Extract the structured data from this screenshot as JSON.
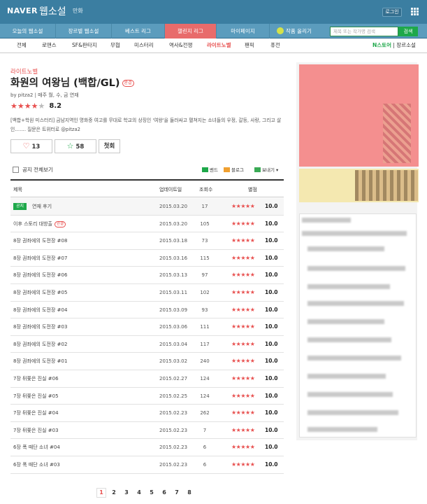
{
  "topbar": {
    "logo": "NAVER",
    "service": "웹소설",
    "comic": "만화",
    "login": "로그인"
  },
  "mainnav": {
    "tabs": [
      {
        "label": "오늘의 웹소설"
      },
      {
        "label": "장르별 웹소설"
      },
      {
        "label": "베스트 리그"
      },
      {
        "label": "챌린지 리그",
        "active": true
      },
      {
        "label": "마이페이지"
      }
    ],
    "upload": "작품 올리기",
    "search_placeholder": "제목 또는 작가명 검색",
    "search_button": "검색"
  },
  "genrenav": {
    "items": [
      "전체",
      "로맨스",
      "SF&판타지",
      "무협",
      "미스터리",
      "역사&전쟁",
      "라이트노벨",
      "팬픽",
      "퓨전"
    ],
    "active": "라이트노벨",
    "nstore_brand": "N스토어",
    "nstore_label": "장르소설"
  },
  "work": {
    "genre": "라이트노벨",
    "title": "화원의 여왕님 (백합/GL)",
    "new_badge": "완결",
    "byline": "by   pitza2   |   매주 월, 수, 금 연재",
    "rating": "8.2",
    "stars_filled": 4,
    "description": "[백합+학원 미스터리] 금남지역인 명화중 여고를 무대로 학교의 상징인 '여왕'을 둘러싸고 펼쳐지는 소녀들의 우정, 갈등, 사랑, 그리고 살인……. 질문은 트위터로 @pitza2",
    "like_count": "13",
    "favorite_count": "58",
    "first_episode": "첫회"
  },
  "list_controls": {
    "notice_toggle": "공지 전체보기",
    "share_band": "밴드",
    "share_blog": "블로그",
    "share_more": "보내기"
  },
  "table": {
    "headers": {
      "title": "제목",
      "date": "업데이트일",
      "views": "조회수",
      "score": "별점"
    },
    "rows": [
      {
        "notice": "공지",
        "title": "연재 후기",
        "date": "2015.03.20",
        "views": "17",
        "score": "10.0"
      },
      {
        "title": "이후 스토리 대방출",
        "new": "완결",
        "date": "2015.03.20",
        "views": "105",
        "score": "10.0"
      },
      {
        "title": "8장 권좌에의 도전장 #08",
        "date": "2015.03.18",
        "views": "73",
        "score": "10.0"
      },
      {
        "title": "8장 권좌에의 도전장 #07",
        "date": "2015.03.16",
        "views": "115",
        "score": "10.0"
      },
      {
        "title": "8장 권좌에의 도전장 #06",
        "date": "2015.03.13",
        "views": "97",
        "score": "10.0"
      },
      {
        "title": "8장 권좌에의 도전장 #05",
        "date": "2015.03.11",
        "views": "102",
        "score": "10.0"
      },
      {
        "title": "8장 권좌에의 도전장 #04",
        "date": "2015.03.09",
        "views": "93",
        "score": "10.0"
      },
      {
        "title": "8장 권좌에의 도전장 #03",
        "date": "2015.03.06",
        "views": "111",
        "score": "10.0"
      },
      {
        "title": "8장 권좌에의 도전장 #02",
        "date": "2015.03.04",
        "views": "117",
        "score": "10.0"
      },
      {
        "title": "8장 권좌에의 도전장 #01",
        "date": "2015.03.02",
        "views": "240",
        "score": "10.0"
      },
      {
        "title": "7장 뒤쫓은 진실 #06",
        "date": "2015.02.27",
        "views": "124",
        "score": "10.0"
      },
      {
        "title": "7장 뒤쫓은 진실 #05",
        "date": "2015.02.25",
        "views": "124",
        "score": "10.0"
      },
      {
        "title": "7장 뒤쫓은 진실 #04",
        "date": "2015.02.23",
        "views": "262",
        "score": "10.0"
      },
      {
        "title": "7장 뒤쫓은 진실 #03",
        "date": "2015.02.23",
        "views": "7",
        "score": "10.0"
      },
      {
        "title": "6장 폭 때단 소녀 #04",
        "date": "2015.02.23",
        "views": "6",
        "score": "10.0"
      },
      {
        "title": "6장 폭 때단 소녀 #03",
        "date": "2015.02.23",
        "views": "6",
        "score": "10.0"
      }
    ],
    "row_stars": "★★★★★"
  },
  "pagination": {
    "pages": [
      "1",
      "2",
      "3",
      "4",
      "5",
      "6",
      "7",
      "8"
    ],
    "current": "1"
  }
}
